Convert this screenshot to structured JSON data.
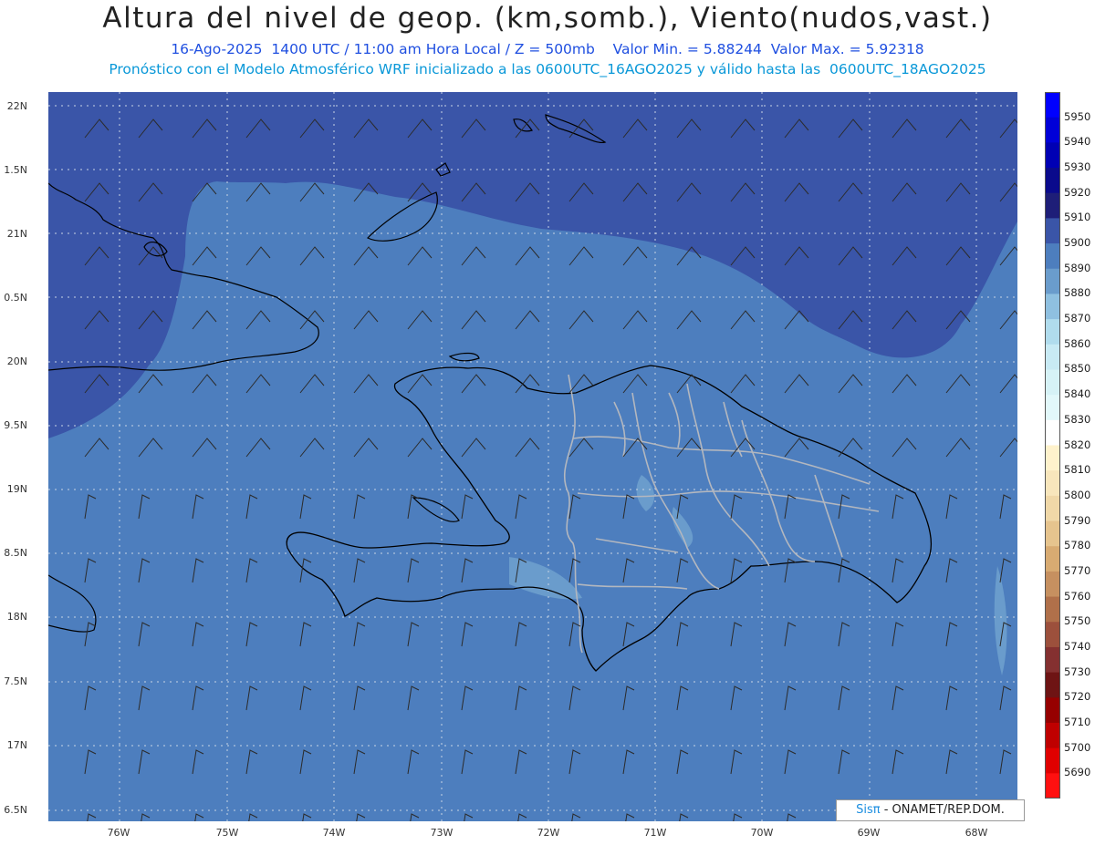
{
  "header": {
    "title": "Altura del nivel de geop. (km,somb.), Viento(nudos,vast.)",
    "line1": "16-Ago-2025  1400 UTC / 11:00 am Hora Local / Z = 500mb    Valor Min. = 5.88244  Valor Max. = 5.92318",
    "line2": "Pronóstico con el Modelo Atmosférico WRF inicializado a las 0600UTC_16AGO2025 y válido hasta las  0600UTC_18AGO2025"
  },
  "axes": {
    "lat_labels": [
      "22N",
      "1.5N",
      "21N",
      "0.5N",
      "20N",
      "9.5N",
      "19N",
      "8.5N",
      "18N",
      "7.5N",
      "17N",
      "6.5N"
    ],
    "lon_labels": [
      "76W",
      "75W",
      "74W",
      "73W",
      "72W",
      "71W",
      "70W",
      "69W",
      "68W"
    ]
  },
  "colorbar": {
    "labels": [
      "5950",
      "5940",
      "5930",
      "5920",
      "5910",
      "5900",
      "5890",
      "5880",
      "5870",
      "5860",
      "5850",
      "5840",
      "5830",
      "5820",
      "5810",
      "5800",
      "5790",
      "5780",
      "5770",
      "5760",
      "5750",
      "5740",
      "5730",
      "5720",
      "5710",
      "5700",
      "5690"
    ],
    "colors": [
      "#0000ff",
      "#0000d8",
      "#0000b4",
      "#0a0a8c",
      "#1e1e78",
      "#3a55a8",
      "#4d7ebe",
      "#6a9ccc",
      "#8fc0e0",
      "#b0dced",
      "#c8eaf4",
      "#d6f2f6",
      "#e2f8fa",
      "#ffffff",
      "#fff2cc",
      "#f8e6bc",
      "#f0d8a8",
      "#e6c48e",
      "#d8ab72",
      "#c69060",
      "#b0704a",
      "#9c503c",
      "#843030",
      "#6e1414",
      "#960000",
      "#bf0000",
      "#e00000",
      "#ff1010"
    ]
  },
  "credit": {
    "sis": "Sisπ",
    "org": " - ONAMET/REP.DOM."
  }
}
